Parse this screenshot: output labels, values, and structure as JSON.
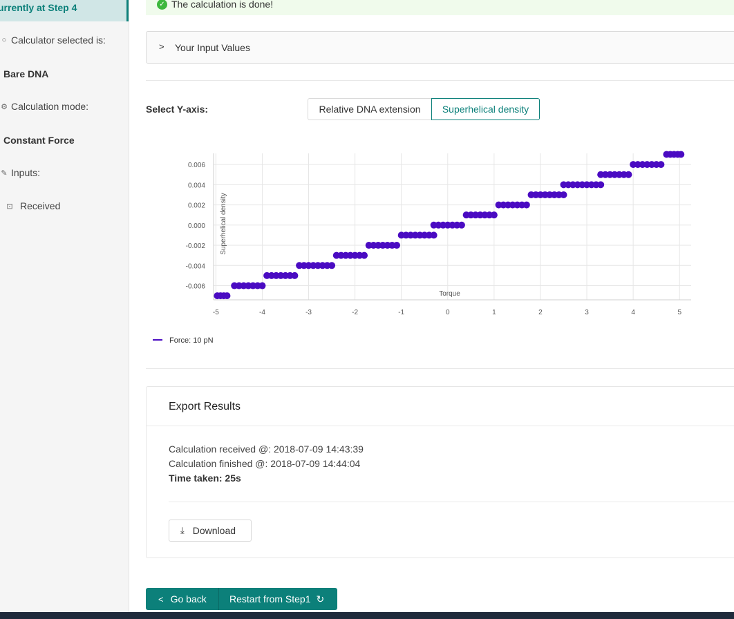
{
  "sidebar": {
    "current_step": "urrently at Step 4",
    "calculator_label": "Calculator selected is:",
    "calculator_value": "Bare DNA",
    "mode_label": "Calculation mode:",
    "mode_value": "Constant Force",
    "inputs_label": "Inputs:",
    "received_label": "Received"
  },
  "alert": {
    "text": "The calculation is done!",
    "color": "#3db83d"
  },
  "input_values": {
    "label": "Your Input Values"
  },
  "yaxis_select": {
    "label": "Select Y-axis:",
    "options": [
      "Relative DNA extension",
      "Superhelical density"
    ],
    "selected": "Superhelical density"
  },
  "chart_data": {
    "type": "scatter",
    "xlabel": "Torque",
    "ylabel": "Superhelical density",
    "xlim": [
      -5.05,
      5.25
    ],
    "ylim": [
      -0.0074,
      0.0071
    ],
    "x_ticks": [
      "-5",
      "-4",
      "-3",
      "-2",
      "-1",
      "0",
      "1",
      "2",
      "3",
      "4",
      "5"
    ],
    "y_ticks": [
      "0.006",
      "0.004",
      "0.002",
      "0.000",
      "-0.002",
      "-0.004",
      "-0.006"
    ],
    "grid": true,
    "legend_position": "bottom-left",
    "series": [
      {
        "name": "Force: 10 pN",
        "color": "#4a0bc2",
        "points": [
          [
            -4.97,
            -0.007
          ],
          [
            -4.9,
            -0.007
          ],
          [
            -4.83,
            -0.007
          ],
          [
            -4.76,
            -0.007
          ],
          [
            -4.6,
            -0.006
          ],
          [
            -4.5,
            -0.006
          ],
          [
            -4.4,
            -0.006
          ],
          [
            -4.3,
            -0.006
          ],
          [
            -4.2,
            -0.006
          ],
          [
            -4.1,
            -0.006
          ],
          [
            -4.0,
            -0.006
          ],
          [
            -3.9,
            -0.005
          ],
          [
            -3.8,
            -0.005
          ],
          [
            -3.7,
            -0.005
          ],
          [
            -3.6,
            -0.005
          ],
          [
            -3.5,
            -0.005
          ],
          [
            -3.4,
            -0.005
          ],
          [
            -3.3,
            -0.005
          ],
          [
            -3.2,
            -0.004
          ],
          [
            -3.1,
            -0.004
          ],
          [
            -3.0,
            -0.004
          ],
          [
            -2.9,
            -0.004
          ],
          [
            -2.8,
            -0.004
          ],
          [
            -2.7,
            -0.004
          ],
          [
            -2.6,
            -0.004
          ],
          [
            -2.5,
            -0.004
          ],
          [
            -2.4,
            -0.003
          ],
          [
            -2.3,
            -0.003
          ],
          [
            -2.2,
            -0.003
          ],
          [
            -2.1,
            -0.003
          ],
          [
            -2.0,
            -0.003
          ],
          [
            -1.9,
            -0.003
          ],
          [
            -1.8,
            -0.003
          ],
          [
            -1.7,
            -0.002
          ],
          [
            -1.6,
            -0.002
          ],
          [
            -1.5,
            -0.002
          ],
          [
            -1.4,
            -0.002
          ],
          [
            -1.3,
            -0.002
          ],
          [
            -1.2,
            -0.002
          ],
          [
            -1.1,
            -0.002
          ],
          [
            -1.0,
            -0.001
          ],
          [
            -0.9,
            -0.001
          ],
          [
            -0.8,
            -0.001
          ],
          [
            -0.7,
            -0.001
          ],
          [
            -0.6,
            -0.001
          ],
          [
            -0.5,
            -0.001
          ],
          [
            -0.4,
            -0.001
          ],
          [
            -0.3,
            -0.001
          ],
          [
            -0.3,
            0.0
          ],
          [
            -0.2,
            0.0
          ],
          [
            -0.1,
            0.0
          ],
          [
            0.0,
            0.0
          ],
          [
            0.1,
            0.0
          ],
          [
            0.2,
            0.0
          ],
          [
            0.3,
            0.0
          ],
          [
            0.4,
            0.001
          ],
          [
            0.5,
            0.001
          ],
          [
            0.6,
            0.001
          ],
          [
            0.7,
            0.001
          ],
          [
            0.8,
            0.001
          ],
          [
            0.9,
            0.001
          ],
          [
            1.0,
            0.001
          ],
          [
            1.1,
            0.002
          ],
          [
            1.2,
            0.002
          ],
          [
            1.3,
            0.002
          ],
          [
            1.4,
            0.002
          ],
          [
            1.5,
            0.002
          ],
          [
            1.6,
            0.002
          ],
          [
            1.7,
            0.002
          ],
          [
            1.8,
            0.003
          ],
          [
            1.9,
            0.003
          ],
          [
            2.0,
            0.003
          ],
          [
            2.1,
            0.003
          ],
          [
            2.2,
            0.003
          ],
          [
            2.3,
            0.003
          ],
          [
            2.4,
            0.003
          ],
          [
            2.5,
            0.003
          ],
          [
            2.5,
            0.004
          ],
          [
            2.6,
            0.004
          ],
          [
            2.7,
            0.004
          ],
          [
            2.8,
            0.004
          ],
          [
            2.9,
            0.004
          ],
          [
            3.0,
            0.004
          ],
          [
            3.1,
            0.004
          ],
          [
            3.2,
            0.004
          ],
          [
            3.3,
            0.004
          ],
          [
            3.3,
            0.005
          ],
          [
            3.4,
            0.005
          ],
          [
            3.5,
            0.005
          ],
          [
            3.6,
            0.005
          ],
          [
            3.7,
            0.005
          ],
          [
            3.8,
            0.005
          ],
          [
            3.9,
            0.005
          ],
          [
            4.0,
            0.006
          ],
          [
            4.1,
            0.006
          ],
          [
            4.2,
            0.006
          ],
          [
            4.3,
            0.006
          ],
          [
            4.4,
            0.006
          ],
          [
            4.5,
            0.006
          ],
          [
            4.6,
            0.006
          ],
          [
            4.72,
            0.007
          ],
          [
            4.8,
            0.007
          ],
          [
            4.88,
            0.007
          ],
          [
            4.96,
            0.007
          ],
          [
            5.03,
            0.007
          ]
        ]
      }
    ]
  },
  "export": {
    "title": "Export Results",
    "received": "Calculation received @: 2018-07-09 14:43:39",
    "finished": "Calculation finished @: 2018-07-09 14:44:04",
    "time_taken": "Time taken: 25s",
    "download_label": "Download"
  },
  "nav": {
    "back_label": "Go back",
    "restart_label": "Restart from Step1",
    "accent": "#0c807a"
  }
}
